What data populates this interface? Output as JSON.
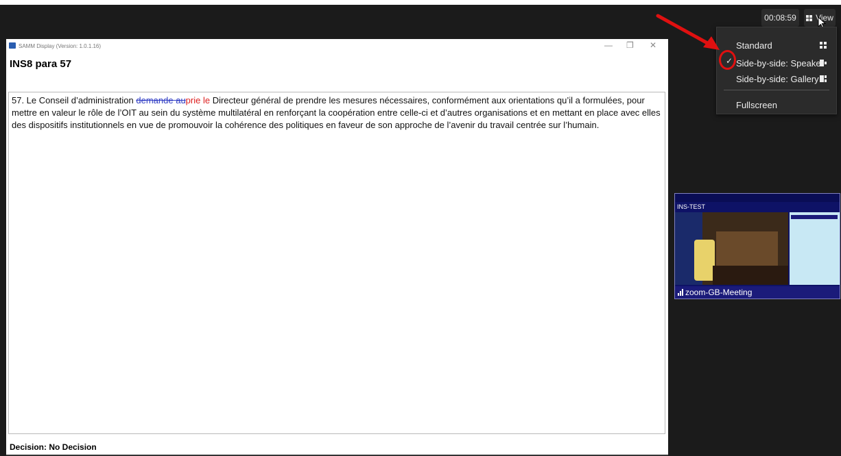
{
  "toolbar": {
    "timer": "00:08:59",
    "view_label": "View"
  },
  "view_menu": {
    "items": [
      {
        "label": "Standard",
        "icon": "grid-icon",
        "checked": false
      },
      {
        "label": "Side-by-side: Speaker",
        "icon": "speaker-layout-icon",
        "checked": true
      },
      {
        "label": "Side-by-side: Gallery",
        "icon": "gallery-layout-icon",
        "checked": false
      },
      {
        "label": "Fullscreen",
        "icon": "",
        "checked": false
      }
    ],
    "check_mark": "✓"
  },
  "samm_window": {
    "app_title": "SAMM Display (Version: 1.0.1.16)",
    "doc_title": "INS8 para 57",
    "paragraph": {
      "prefix": "57. Le Conseil d’administration ",
      "deleted": "demande au",
      "inserted": "prie le",
      "rest": " Directeur général de prendre les mesures nécessaires, conformément aux orientations qu’il a formulées, pour mettre en valeur le rôle de l’OIT au sein du système multilatéral en renforçant la coopération entre celle-ci et d’autres organisations et en mettant en place avec elles des dispositifs institutionnels en vue de promouvoir la cohérence des politiques en faveur de son approche de l’avenir du travail centrée sur l’humain."
    },
    "decision": "Decision: No Decision"
  },
  "participant_thumb": {
    "heading": "INS-TEST",
    "name": "zoom-GB-Meeting"
  },
  "colors": {
    "annotation_red": "#e01010",
    "deleted_text": "#2f3cc4",
    "inserted_text": "#dd1e1e"
  }
}
